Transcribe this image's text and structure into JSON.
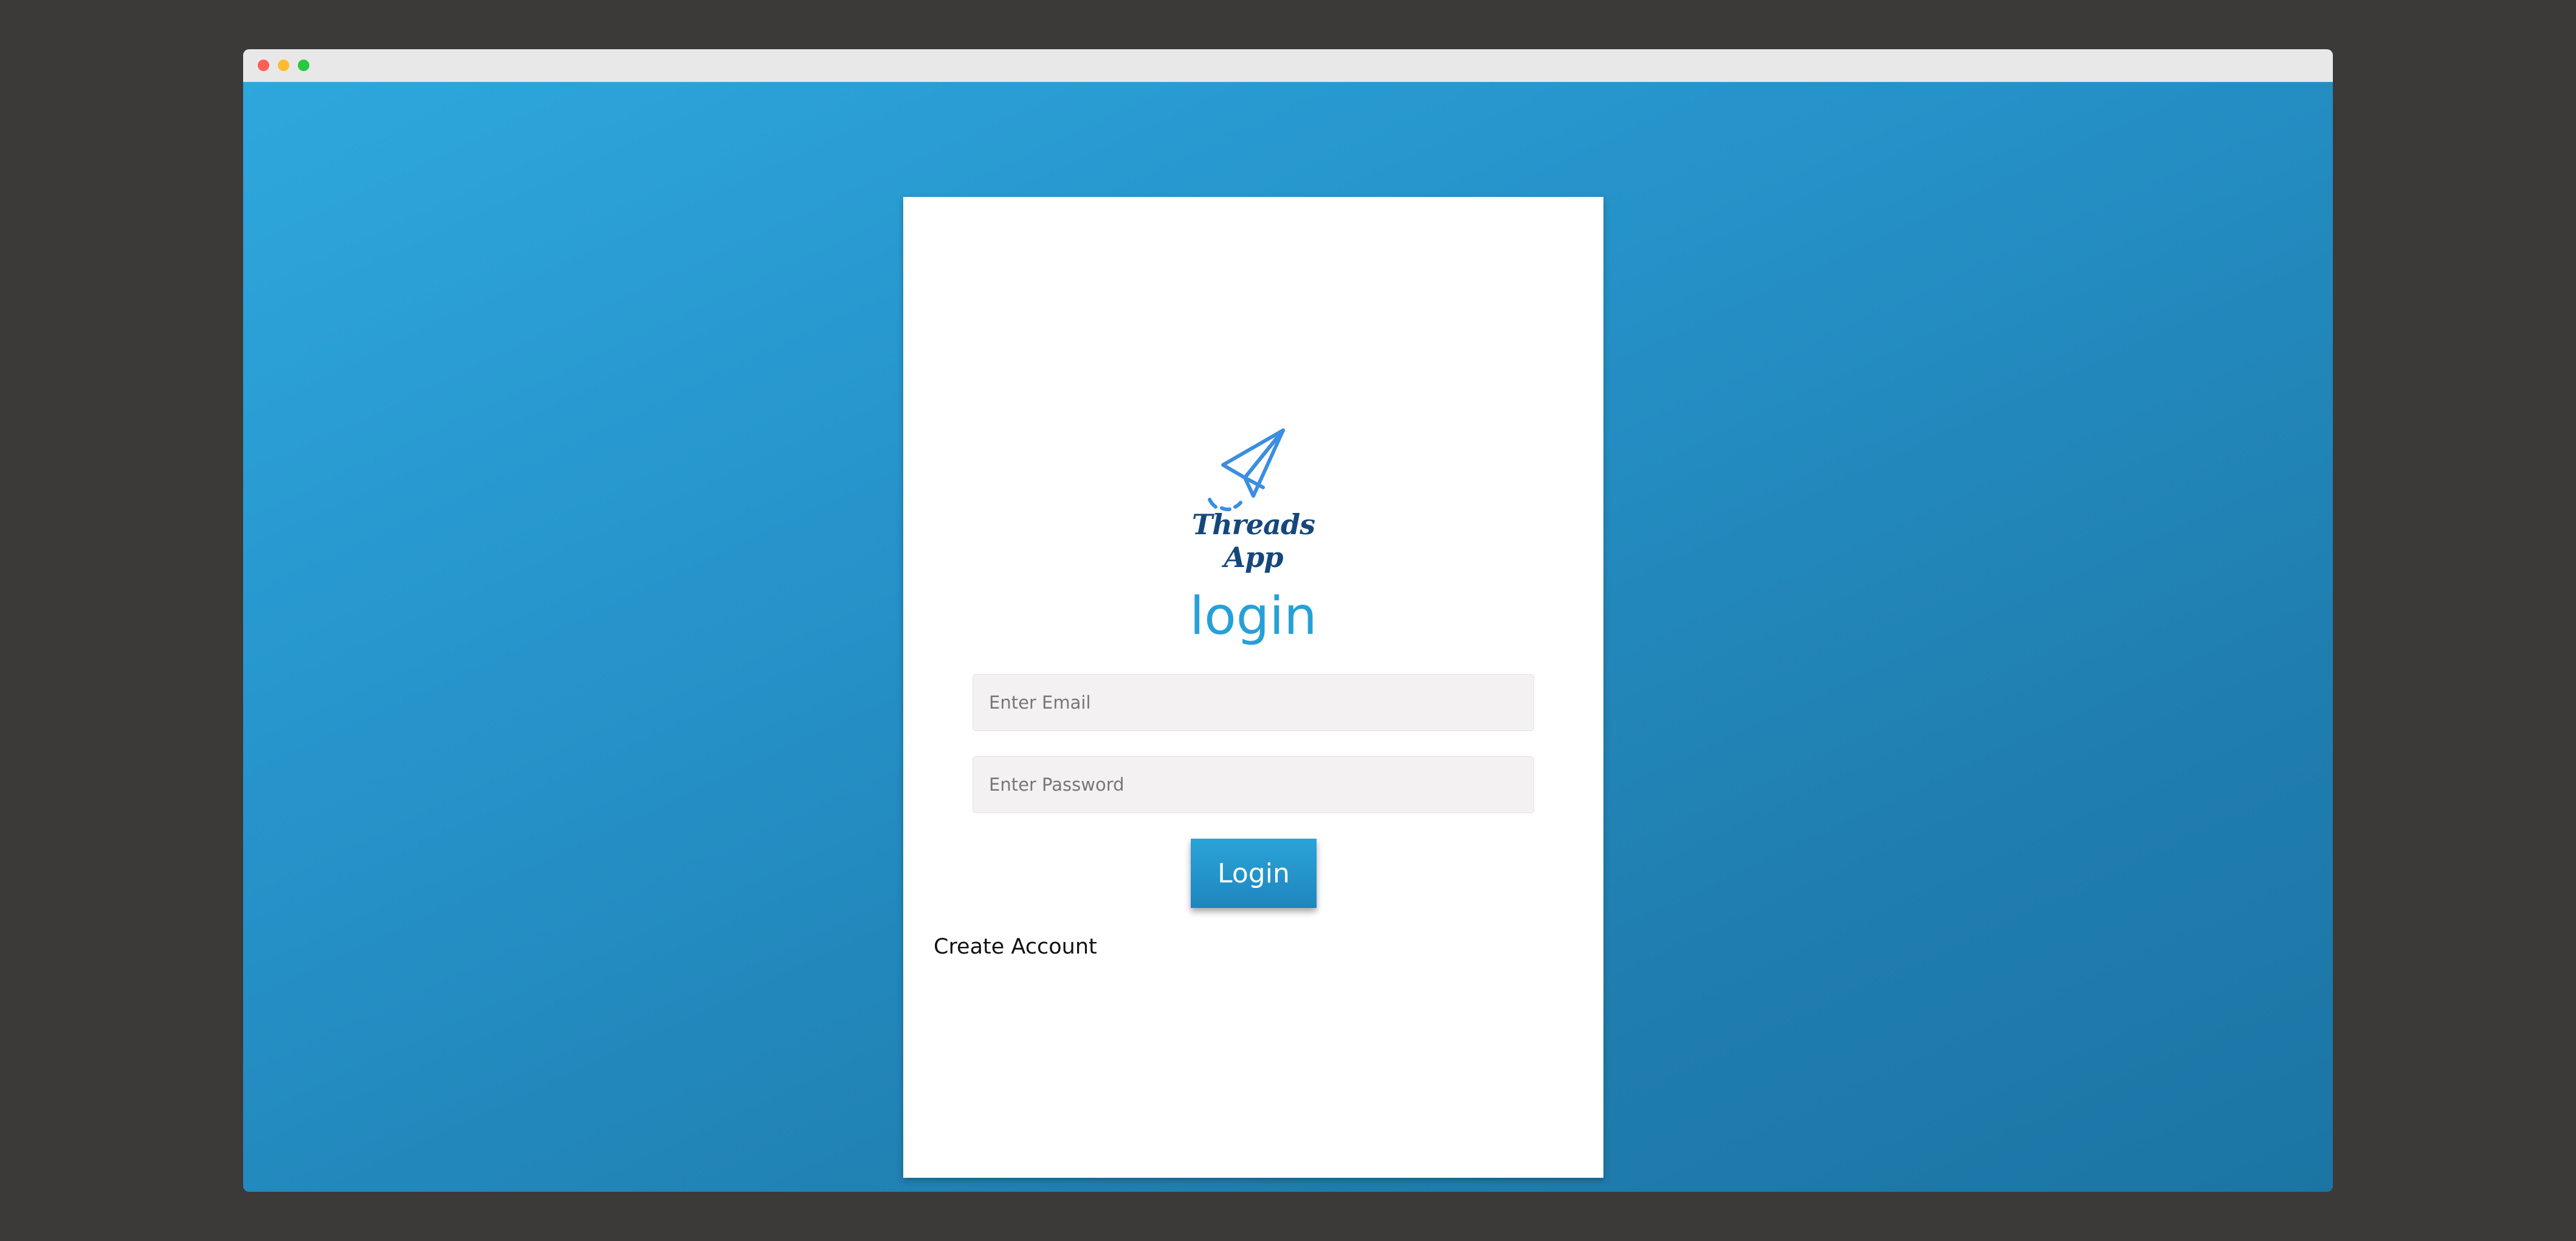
{
  "app": {
    "logo_text": "Threads App"
  },
  "login_form": {
    "title": "login",
    "email_placeholder": "Enter Email",
    "password_placeholder": "Enter Password",
    "submit_label": "Login",
    "create_account_label": "Create Account"
  },
  "colors": {
    "accent": "#27a0d8",
    "logo": "#16477b",
    "background_gradient": [
      "#2ea7dd",
      "#1b75a4"
    ]
  },
  "icons": {
    "logo": "paper-plane-icon"
  }
}
